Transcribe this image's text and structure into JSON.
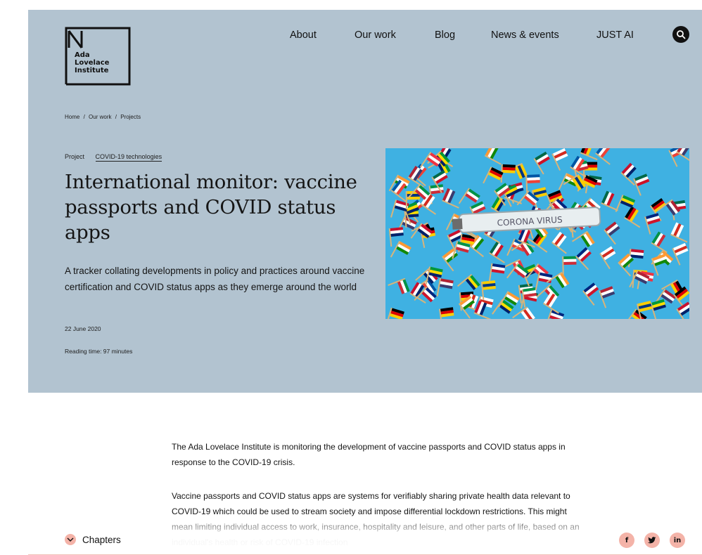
{
  "logo": {
    "lines": [
      "Ada",
      "Lovelace",
      "Institute"
    ]
  },
  "nav": {
    "items": [
      "About",
      "Our work",
      "Blog",
      "News & events",
      "JUST AI"
    ]
  },
  "breadcrumb": {
    "items": [
      "Home",
      "/",
      "Our work",
      "/",
      "Projects"
    ]
  },
  "tags": {
    "type": "Project",
    "topic": "COVID-19 technologies"
  },
  "hero": {
    "title": "International monitor: vaccine passports and COVID status apps",
    "subtitle": "A tracker collating developments in policy and practices around vaccine certification and COVID status apps as they emerge around the world",
    "date": "22 June 2020",
    "reading_time": "Reading time: 97 minutes",
    "image_text": "CORONA VIRUS"
  },
  "body": {
    "p1": "The Ada Lovelace Institute is monitoring the development of vaccine passports and COVID status apps in response to the COVID-19 crisis.",
    "p2": "Vaccine passports and COVID status apps are systems for verifiably sharing private health data relevant to COVID-19 which could be used to stream society and impose differential lockdown restrictions. This might mean limiting individual access to work, insurance, hospitality and leisure, and other parts of life, based on an individual's health or risk of COVID-19 infection"
  },
  "footer": {
    "chapters_label": "Chapters",
    "social": [
      {
        "icon": "facebook-icon",
        "glyph": "f"
      },
      {
        "icon": "twitter-icon",
        "glyph": "t"
      },
      {
        "icon": "linkedin-icon",
        "glyph": "in"
      }
    ]
  },
  "colors": {
    "hero_bg": "#b2c3d0",
    "accent": "#f4b3a8",
    "image_bg": "#3fb1e2"
  }
}
